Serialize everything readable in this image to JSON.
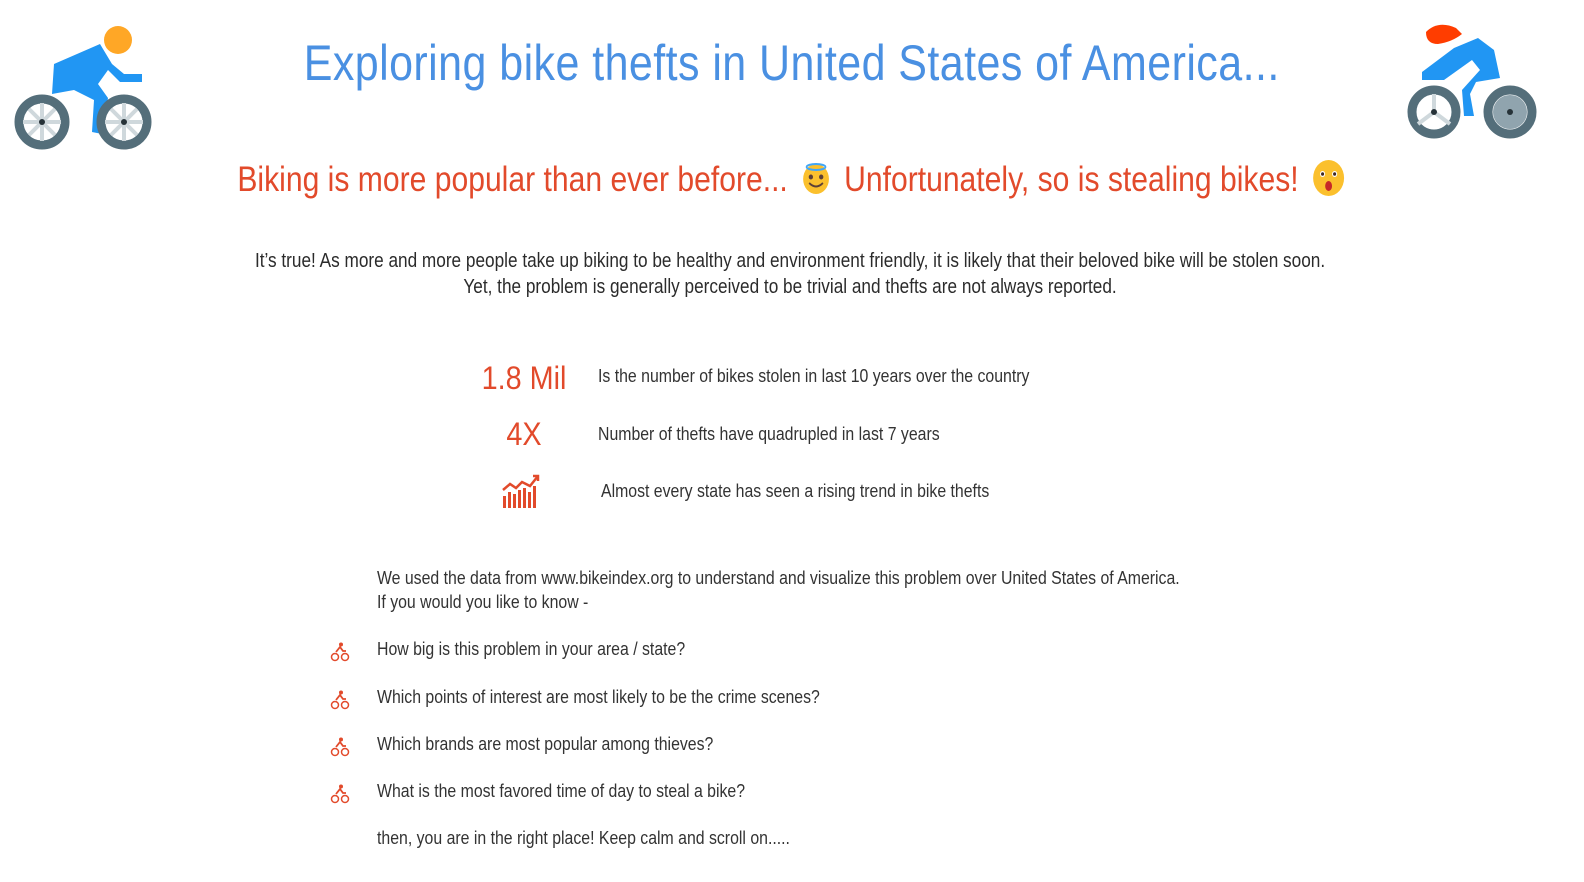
{
  "page": {
    "title": "Exploring bike thefts in United States of America...",
    "subtitle_part1": "Biking is more popular than ever before...",
    "subtitle_part2": "Unfortunately, so is stealing bikes!",
    "intro_line1": "It’s true! As more and more people take up biking to be healthy and environment friendly, it is likely that their beloved bike will be stolen soon.",
    "intro_line2": "Yet, the problem is generally perceived to be trivial and thefts are not always reported."
  },
  "icons": {
    "left_cyclist": "cyclist-icon",
    "right_cyclist": "cyclist-icon",
    "subtitle_emoji_1": "smiling-halo-emoji",
    "subtitle_emoji_2": "astonished-emoji",
    "trend": "trend-chart-icon",
    "question_bullet": "bike-rider-icon"
  },
  "stats": [
    {
      "value": "1.8 Mil",
      "text": "Is the number of bikes stolen in last 10 years over the country"
    },
    {
      "value": "4X",
      "text": "Number of thefts have quadrupled in last 7 years"
    },
    {
      "value": "",
      "text": "Almost every state has seen a rising trend in bike thefts"
    }
  ],
  "data_intro": {
    "line1": "We used the data from www.bikeindex.org to understand and visualize this problem over United States of America.",
    "line2": "If you would you like to know -"
  },
  "questions": [
    "How big is this problem in your area / state?",
    "Which points of interest are most likely to be the crime scenes?",
    "Which brands are most popular among thieves?",
    "What is the most favored time of day to steal a bike?"
  ],
  "closing": "then, you are in the right place! Keep calm and scroll on.....",
  "colors": {
    "title_blue": "#4a90e2",
    "accent_red": "#e24a2b",
    "text_dark": "#333333",
    "wheel_gray": "#546e7a",
    "rider_blue": "#2196f3",
    "helmet_orange": "#ffa726"
  }
}
